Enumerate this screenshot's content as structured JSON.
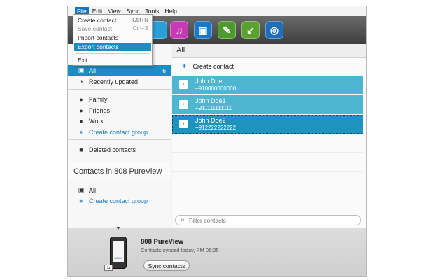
{
  "menubar": {
    "items": [
      "File",
      "Edit",
      "View",
      "Sync",
      "Tools",
      "Help"
    ]
  },
  "file_menu": {
    "items": [
      {
        "label": "Create contact",
        "shortcut": "Ctrl+N"
      },
      {
        "label": "Save contact",
        "shortcut": "Ctrl+S"
      },
      {
        "label": "Import contacts",
        "shortcut": ""
      },
      {
        "label": "Export contacts",
        "shortcut": ""
      },
      {
        "label": "Exit",
        "shortcut": ""
      }
    ]
  },
  "toolbar": {
    "icons": [
      "contacts-icon",
      "music-icon",
      "store-icon",
      "tools-icon",
      "download-icon",
      "support-icon"
    ],
    "colors": {
      "contacts": "#2a9fd8",
      "music": "#c43bb4",
      "store": "#1a79c6",
      "tools": "#4f9a2c",
      "download": "#5aa12f",
      "support": "#1c6fb8"
    }
  },
  "sidebar": {
    "all": {
      "label": "All",
      "count": "6"
    },
    "recently_updated": "Recently updated",
    "groups": [
      "Family",
      "Friends",
      "Work"
    ],
    "create_group": "Create contact group",
    "deleted": "Deleted contacts",
    "device_header": "Contacts in 808 PureView",
    "device_all": "All",
    "device_create_group": "Create contact group"
  },
  "main": {
    "title": "All",
    "create_contact": "Create contact",
    "contacts": [
      {
        "name": "John Doe",
        "phone": "+910000000000"
      },
      {
        "name": "John Doe1",
        "phone": "+911111111111"
      },
      {
        "name": "John Doe2",
        "phone": "+912222222222"
      }
    ],
    "filter_placeholder": "Filter contacts"
  },
  "device": {
    "name": "808 PureView",
    "status": "Contacts synced today, PM 06:25",
    "sync_label": "Sync contacts",
    "phone_brand": "NOKIA"
  },
  "colors": {
    "accent": "#1a8dc4",
    "contact_row": "#4fb6d2",
    "contact_selected": "#1d93bd",
    "link": "#1b7cc0"
  }
}
